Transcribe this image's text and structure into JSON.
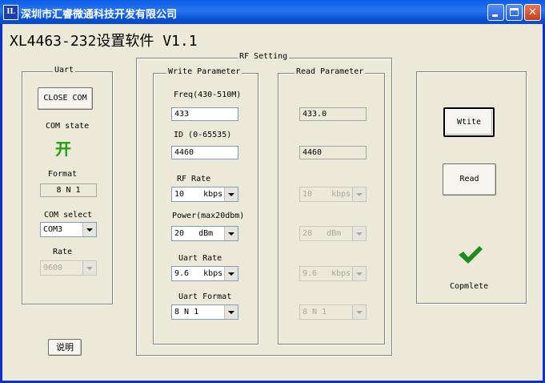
{
  "window": {
    "title": "深圳市汇睿微通科技开发有限公司",
    "app_icon_text": "IL",
    "heading": "XL4463-232设置软件  V1.1"
  },
  "uart": {
    "group_label": "Uart",
    "close_button": "CLOSE COM",
    "com_state_label": "COM state",
    "com_state_value": "开",
    "format_label": "Format",
    "format_value": "8  N  1",
    "com_select_label": "COM select",
    "com_select_value": "COM3",
    "rate_label": "Rate",
    "rate_value": "9600"
  },
  "explain_button": "说明",
  "rf_setting": {
    "group_label": "RF Setting",
    "write": {
      "group_label": "Write Parameter",
      "freq_label": "Freq(430-510M)",
      "freq_value": "433",
      "id_label": "ID  (0-65535)",
      "id_value": "4460",
      "rf_rate_label": "RF Rate",
      "rf_rate_value": "10    kbps",
      "power_label": "Power(max20dbm)",
      "power_value": "20   dBm",
      "uart_rate_label": "Uart Rate",
      "uart_rate_value": "9.6   kbps",
      "uart_format_label": "Uart Format",
      "uart_format_value": "8 N 1"
    },
    "read": {
      "group_label": "Read Parameter",
      "freq_value": "433.0",
      "id_value": "4460",
      "rf_rate_value": "10    kbps",
      "power_value": "20   dBm",
      "uart_rate_value": "9.6   kbps",
      "uart_format_value": "8 N 1"
    }
  },
  "actions": {
    "write_button": "Wtite",
    "read_button": "Read",
    "status_text": "Copmlete"
  },
  "colors": {
    "titlebar": "#0a5ce8",
    "window_bg": "#ece9d8",
    "state_green": "#1aa010",
    "check_green": "#1e8c1e"
  }
}
